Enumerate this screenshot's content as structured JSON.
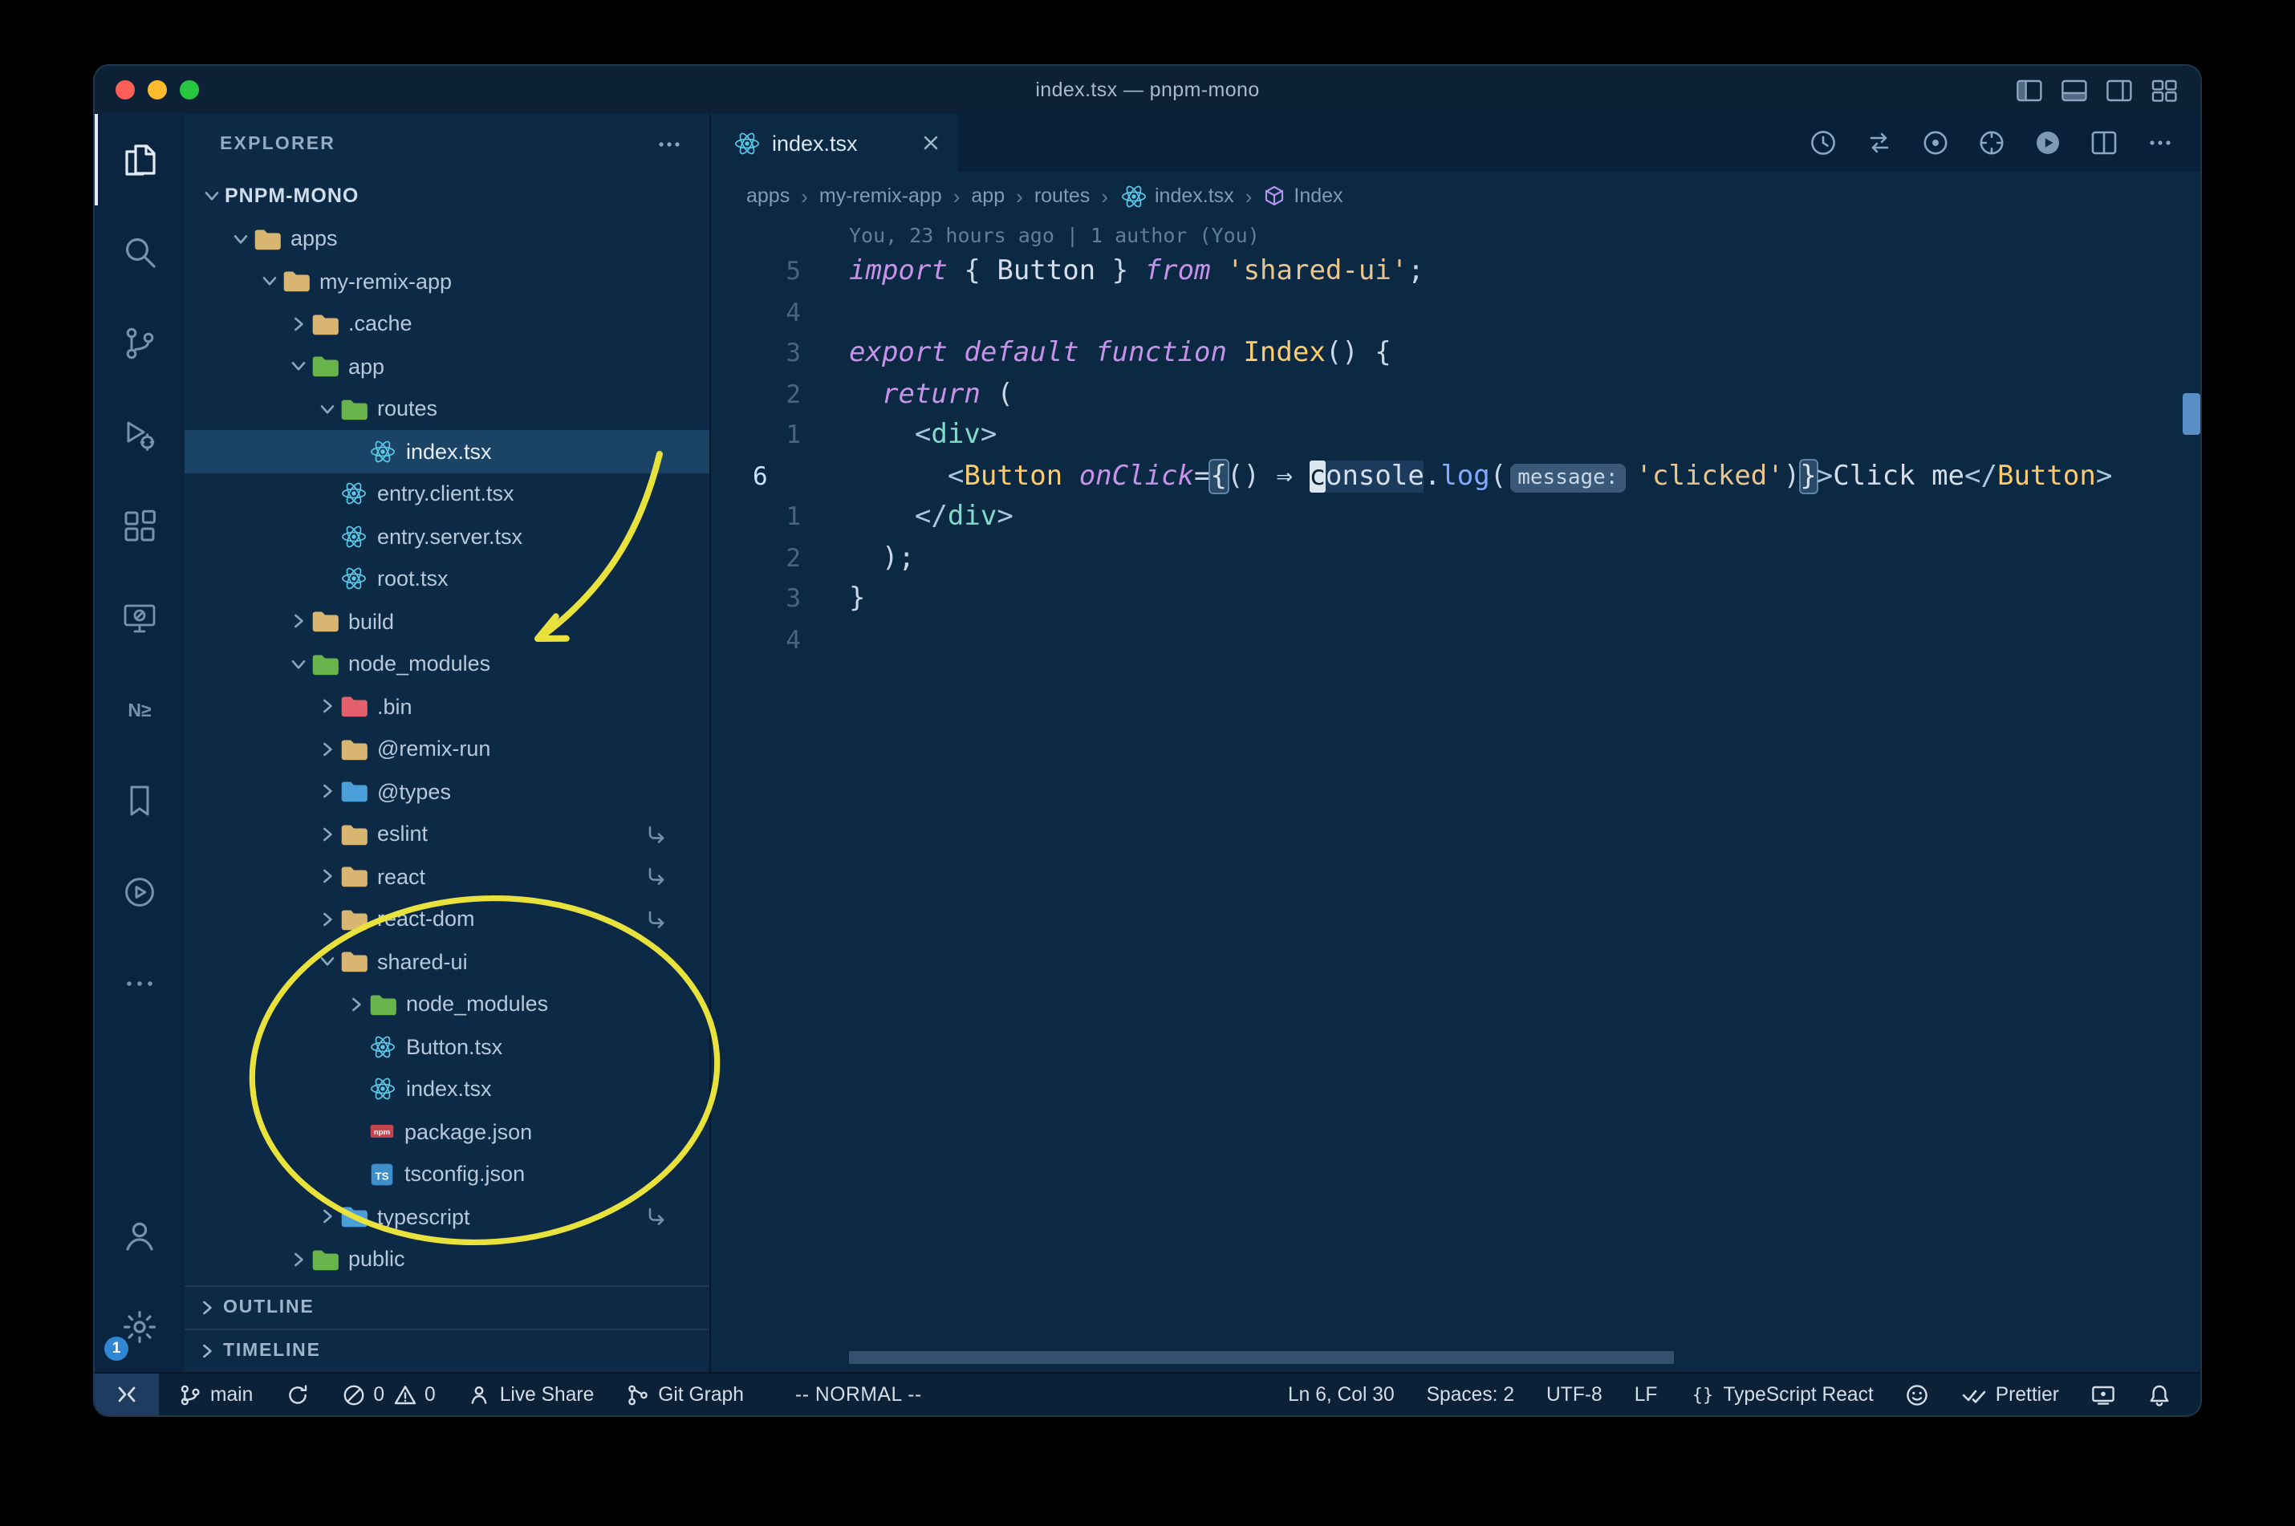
{
  "window": {
    "title": "index.tsx — pnpm-mono"
  },
  "titlebar": {
    "icons": [
      "layout-sidebar",
      "layout-panel",
      "layout-sidebar-right",
      "layout-grid"
    ]
  },
  "activity_bar": {
    "top": [
      {
        "name": "explorer",
        "icon": "files",
        "active": true
      },
      {
        "name": "search",
        "icon": "search"
      },
      {
        "name": "source-control",
        "icon": "git-branch-lg"
      },
      {
        "name": "run-and-debug",
        "icon": "debug"
      },
      {
        "name": "extensions",
        "icon": "extensions"
      },
      {
        "name": "remote-explorer",
        "icon": "remote"
      },
      {
        "name": "nx-console",
        "icon": "nx"
      },
      {
        "name": "bookmarks",
        "icon": "bookmark"
      },
      {
        "name": "code-runner",
        "icon": "play-circle"
      },
      {
        "name": "more-views",
        "icon": "ellipsis"
      }
    ],
    "bottom": [
      {
        "name": "accounts",
        "icon": "account"
      },
      {
        "name": "settings",
        "icon": "gear",
        "badge": "1"
      }
    ]
  },
  "explorer": {
    "title": "EXPLORER",
    "tree": [
      {
        "label": "PNPM-MONO",
        "level": 0,
        "chevron": "down",
        "root": true
      },
      {
        "label": "apps",
        "level": 1,
        "chevron": "down",
        "icon": "folder",
        "color": "tan"
      },
      {
        "label": "my-remix-app",
        "level": 2,
        "chevron": "down",
        "icon": "folder",
        "color": "tan"
      },
      {
        "label": ".cache",
        "level": 3,
        "chevron": "right",
        "icon": "folder",
        "color": "tan"
      },
      {
        "label": "app",
        "level": 3,
        "chevron": "down",
        "icon": "folder",
        "color": "green"
      },
      {
        "label": "routes",
        "level": 4,
        "chevron": "down",
        "icon": "folder",
        "color": "green"
      },
      {
        "label": "index.tsx",
        "level": 5,
        "icon": "react",
        "selected": true
      },
      {
        "label": "entry.client.tsx",
        "level": 4,
        "icon": "react"
      },
      {
        "label": "entry.server.tsx",
        "level": 4,
        "icon": "react"
      },
      {
        "label": "root.tsx",
        "level": 4,
        "icon": "react"
      },
      {
        "label": "build",
        "level": 3,
        "chevron": "right",
        "icon": "folder",
        "color": "tan"
      },
      {
        "label": "node_modules",
        "level": 3,
        "chevron": "down",
        "icon": "folder",
        "color": "green"
      },
      {
        "label": ".bin",
        "level": 4,
        "chevron": "right",
        "icon": "folder",
        "color": "red"
      },
      {
        "label": "@remix-run",
        "level": 4,
        "chevron": "right",
        "icon": "folder",
        "color": "tan"
      },
      {
        "label": "@types",
        "level": 4,
        "chevron": "right",
        "icon": "folder",
        "color": "blue"
      },
      {
        "label": "eslint",
        "level": 4,
        "chevron": "right",
        "icon": "folder",
        "color": "tan",
        "symlink": true
      },
      {
        "label": "react",
        "level": 4,
        "chevron": "right",
        "icon": "folder",
        "color": "tan",
        "symlink": true
      },
      {
        "label": "react-dom",
        "level": 4,
        "chevron": "right",
        "icon": "folder",
        "color": "tan",
        "symlink": true
      },
      {
        "label": "shared-ui",
        "level": 4,
        "chevron": "down",
        "icon": "folder",
        "color": "tan"
      },
      {
        "label": "node_modules",
        "level": 5,
        "chevron": "right",
        "icon": "folder",
        "color": "green"
      },
      {
        "label": "Button.tsx",
        "level": 5,
        "icon": "react"
      },
      {
        "label": "index.tsx",
        "level": 5,
        "icon": "react"
      },
      {
        "label": "package.json",
        "level": 5,
        "icon": "npm"
      },
      {
        "label": "tsconfig.json",
        "level": 5,
        "icon": "ts"
      },
      {
        "label": "typescript",
        "level": 4,
        "chevron": "right",
        "icon": "folder",
        "color": "blue",
        "symlink": true
      },
      {
        "label": "public",
        "level": 3,
        "chevron": "right",
        "icon": "folder",
        "color": "green"
      }
    ],
    "sections": [
      {
        "label": "OUTLINE"
      },
      {
        "label": "TIMELINE"
      }
    ]
  },
  "editor": {
    "tab": {
      "label": "index.tsx"
    },
    "tab_actions": [
      "history",
      "compare-changes",
      "record",
      "target",
      "run-file",
      "split-editor",
      "more-actions"
    ],
    "breadcrumb_separator": "›",
    "breadcrumbs": [
      {
        "label": "apps"
      },
      {
        "label": "my-remix-app"
      },
      {
        "label": "app"
      },
      {
        "label": "routes"
      },
      {
        "label": "index.tsx",
        "icon": "react"
      },
      {
        "label": "Index",
        "icon": "symbol-module"
      }
    ],
    "codelens": "You, 23 hours ago | 1 author (You)",
    "lines": [
      {
        "num": "5",
        "tokens": [
          [
            "import",
            "kw"
          ],
          [
            " ",
            ""
          ],
          [
            "{",
            "pn"
          ],
          [
            " ",
            ""
          ],
          [
            "Button",
            "var"
          ],
          [
            " ",
            ""
          ],
          [
            "}",
            "pn"
          ],
          [
            " ",
            ""
          ],
          [
            "from",
            "kw"
          ],
          [
            " ",
            ""
          ],
          [
            "'shared-ui'",
            "str"
          ],
          [
            ";",
            "pn"
          ]
        ]
      },
      {
        "num": "4",
        "tokens": []
      },
      {
        "num": "3",
        "tokens": [
          [
            "export",
            "kw"
          ],
          [
            " ",
            ""
          ],
          [
            "default",
            "kw"
          ],
          [
            " ",
            ""
          ],
          [
            "function",
            "kw"
          ],
          [
            " ",
            ""
          ],
          [
            "Index",
            "fn"
          ],
          [
            "()",
            "pn"
          ],
          [
            " ",
            ""
          ],
          [
            "{",
            "pn"
          ]
        ]
      },
      {
        "num": "2",
        "tokens": [
          [
            "  ",
            ""
          ],
          [
            "return",
            "kw"
          ],
          [
            " ",
            ""
          ],
          [
            "(",
            "pn"
          ]
        ]
      },
      {
        "num": "1",
        "tokens": [
          [
            "    ",
            ""
          ],
          [
            "<",
            "tagb"
          ],
          [
            "div",
            "tag"
          ],
          [
            ">",
            "tagb"
          ]
        ]
      },
      {
        "num": "6",
        "current": true,
        "tokens": [
          [
            "      ",
            ""
          ],
          [
            "<",
            "tagb"
          ],
          [
            "Button",
            "comp"
          ],
          [
            " ",
            ""
          ],
          [
            "onClick",
            "attr"
          ],
          [
            "=",
            "pn"
          ],
          [
            "{",
            "match"
          ],
          [
            "()",
            "pn"
          ],
          [
            " ",
            ""
          ],
          [
            "⇒",
            "arrow"
          ],
          [
            " ",
            ""
          ],
          [
            "c",
            "cursor"
          ],
          [
            "onsole",
            "hl"
          ],
          [
            ".",
            "pn"
          ],
          [
            "log",
            "prop"
          ],
          [
            "(",
            "pn"
          ],
          [
            "message:",
            "inlay"
          ],
          [
            "'clicked'",
            "str"
          ],
          [
            ")",
            "pn"
          ],
          [
            "}",
            "match"
          ],
          [
            ">",
            "tagb"
          ],
          [
            "Click me",
            "text"
          ],
          [
            "</",
            "tagb"
          ],
          [
            "Button",
            "comp"
          ],
          [
            ">",
            "tagb"
          ]
        ]
      },
      {
        "num": "1",
        "tokens": [
          [
            "    ",
            ""
          ],
          [
            "</",
            "tagb"
          ],
          [
            "div",
            "tag"
          ],
          [
            ">",
            "tagb"
          ]
        ]
      },
      {
        "num": "2",
        "tokens": [
          [
            "  ",
            ""
          ],
          [
            ");",
            "pn"
          ]
        ]
      },
      {
        "num": "3",
        "tokens": [
          [
            "}",
            "pn"
          ]
        ]
      },
      {
        "num": "4",
        "tokens": []
      }
    ]
  },
  "status_bar": {
    "left": [
      {
        "name": "remote",
        "icon": "remote-indicator"
      },
      {
        "name": "branch",
        "icon": "branch",
        "label": "main"
      },
      {
        "name": "sync",
        "icon": "sync"
      },
      {
        "name": "problems",
        "parts": [
          {
            "icon": "error",
            "label": "0"
          },
          {
            "icon": "warning",
            "label": "0"
          }
        ]
      },
      {
        "name": "live-share",
        "icon": "live-share",
        "label": "Live Share"
      },
      {
        "name": "git-graph",
        "icon": "git-graph",
        "label": "Git Graph"
      },
      {
        "name": "vim-mode",
        "label": "-- NORMAL --"
      }
    ],
    "right": [
      {
        "name": "cursor-position",
        "label": "Ln 6, Col 30"
      },
      {
        "name": "indentation",
        "label": "Spaces: 2"
      },
      {
        "name": "encoding",
        "label": "UTF-8"
      },
      {
        "name": "eol",
        "label": "LF"
      },
      {
        "name": "language-mode",
        "icon": "braces",
        "label": "TypeScript React"
      },
      {
        "name": "feedback",
        "icon": "smiley"
      },
      {
        "name": "prettier",
        "icon": "double-check",
        "label": "Prettier"
      },
      {
        "name": "screencast",
        "icon": "screencast"
      },
      {
        "name": "notifications",
        "icon": "bell"
      }
    ]
  },
  "annotations": {
    "color": "#e9e23d",
    "shapes": [
      "hand-drawn arrow pointing to node_modules",
      "hand-drawn ellipse circling shared-ui contents"
    ]
  },
  "colors": {
    "editor_bg": "#0b2942",
    "sidebar_bg": "#0c2a46",
    "activity_bg": "#0b2440",
    "titlebar_bg": "#0c2136",
    "statusbar_bg": "#0b2138",
    "selection_row": "#1b4366",
    "badge_blue": "#2f86d2",
    "accent_yellow": "#e9e23d"
  }
}
